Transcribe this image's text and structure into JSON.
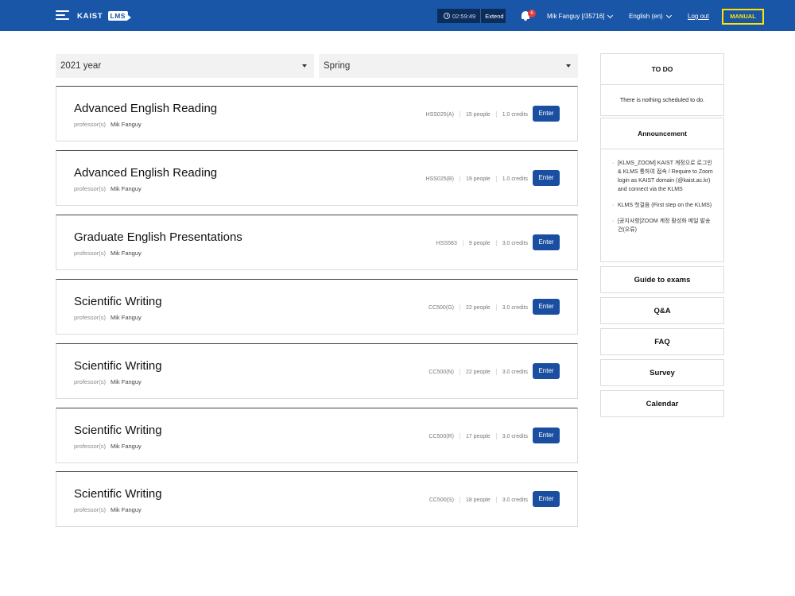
{
  "header": {
    "logo_kaist": "KAIST",
    "logo_lms": "LMS",
    "session_time": "02:59:49",
    "extend_label": "Extend",
    "notification_count": "6",
    "user_label": "Mik Fanguy [/35716]",
    "language_label": "English (en)",
    "logout_label": "Log out",
    "manual_label": "MANUAL"
  },
  "filters": {
    "year": "2021 year",
    "semester": "Spring"
  },
  "courses": [
    {
      "title": "Advanced English Reading",
      "professor_label": "professor(s)",
      "professor": "Mik Fanguy",
      "code": "HSS025(A)",
      "people": "15 people",
      "credits": "1.0 credits",
      "enter_label": "Enter"
    },
    {
      "title": "Advanced English Reading",
      "professor_label": "professor(s)",
      "professor": "Mik Fanguy",
      "code": "HSS025(B)",
      "people": "19 people",
      "credits": "1.0 credits",
      "enter_label": "Enter"
    },
    {
      "title": "Graduate English Presentations",
      "professor_label": "professor(s)",
      "professor": "Mik Fanguy",
      "code": "HSS583",
      "people": "9 people",
      "credits": "3.0 credits",
      "enter_label": "Enter"
    },
    {
      "title": "Scientific Writing",
      "professor_label": "professor(s)",
      "professor": "Mik Fanguy",
      "code": "CC500(G)",
      "people": "22 people",
      "credits": "3.0 credits",
      "enter_label": "Enter"
    },
    {
      "title": "Scientific Writing",
      "professor_label": "professor(s)",
      "professor": "Mik Fanguy",
      "code": "CC500(N)",
      "people": "22 people",
      "credits": "3.0 credits",
      "enter_label": "Enter"
    },
    {
      "title": "Scientific Writing",
      "professor_label": "professor(s)",
      "professor": "Mik Fanguy",
      "code": "CC500(R)",
      "people": "17 people",
      "credits": "3.0 credits",
      "enter_label": "Enter"
    },
    {
      "title": "Scientific Writing",
      "professor_label": "professor(s)",
      "professor": "Mik Fanguy",
      "code": "CC500(S)",
      "people": "18 people",
      "credits": "3.0 credits",
      "enter_label": "Enter"
    }
  ],
  "sidebar": {
    "todo_title": "TO DO",
    "todo_message": "There is nothing scheduled to do.",
    "announcement_title": "Announcement",
    "announcements": [
      "[KLMS_ZOOM] KAIST 계정으로 로그인 & KLMS 통하여 접속 / Require to Zoom login as KAIST domain (@kaist.ac.kr) and connect via the KLMS",
      "KLMS 첫걸음 (First step on the KLMS)",
      "[공지사항]ZOOM 계정 활성화 메일 발송 건(오류)"
    ],
    "links": [
      "Guide to exams",
      "Q&A",
      "FAQ",
      "Survey",
      "Calendar"
    ]
  }
}
